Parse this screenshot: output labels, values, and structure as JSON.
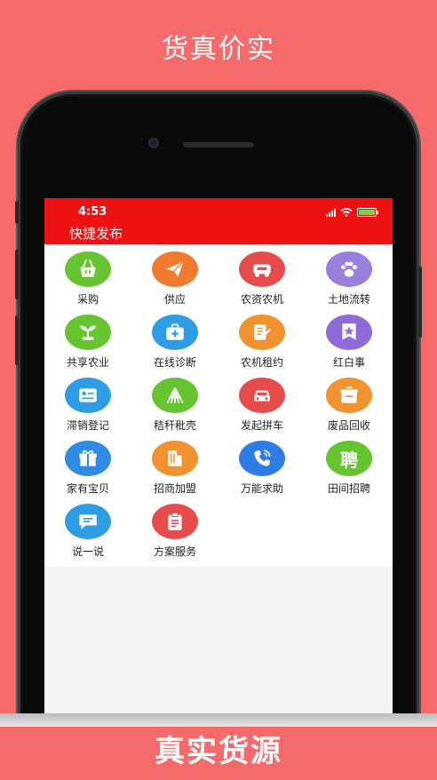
{
  "promo": {
    "top_caption": "货真价实",
    "bottom_caption": "真实货源"
  },
  "status_bar": {
    "time": "4:53"
  },
  "app": {
    "title": "快捷发布"
  },
  "items": [
    {
      "label": "采购",
      "icon": "shopping-basket-icon",
      "color": "#66c431"
    },
    {
      "label": "供应",
      "icon": "paper-plane-icon",
      "color": "#f07a2f"
    },
    {
      "label": "农资农机",
      "icon": "tractor-icon",
      "color": "#e64c4c"
    },
    {
      "label": "土地流转",
      "icon": "paw-icon",
      "color": "#9a7fdc"
    },
    {
      "label": "共享农业",
      "icon": "sprout-icon",
      "color": "#66c431"
    },
    {
      "label": "在线诊断",
      "icon": "medical-kit-icon",
      "color": "#2f9de4"
    },
    {
      "label": "农机租约",
      "icon": "contract-icon",
      "color": "#f0922f"
    },
    {
      "label": "红白事",
      "icon": "star-badge-icon",
      "color": "#8e6bd8"
    },
    {
      "label": "滞销登记",
      "icon": "id-card-icon",
      "color": "#2f9de4"
    },
    {
      "label": "秸秆秕壳",
      "icon": "straw-icon",
      "color": "#66c431"
    },
    {
      "label": "发起拼车",
      "icon": "car-icon",
      "color": "#e64c4c"
    },
    {
      "label": "废品回收",
      "icon": "recycle-box-icon",
      "color": "#f0922f"
    },
    {
      "label": "家有宝贝",
      "icon": "gift-icon",
      "color": "#2f8be4"
    },
    {
      "label": "招商加盟",
      "icon": "building-icon",
      "color": "#f0922f"
    },
    {
      "label": "万能求助",
      "icon": "phone-call-icon",
      "color": "#2f7de4"
    },
    {
      "label": "田间招聘",
      "icon": "recruit-icon",
      "color": "#66c431",
      "glyph": "聘"
    },
    {
      "label": "说一说",
      "icon": "chat-icon",
      "color": "#2f9de4"
    },
    {
      "label": "方案服务",
      "icon": "clipboard-icon",
      "color": "#e64c4c"
    }
  ]
}
